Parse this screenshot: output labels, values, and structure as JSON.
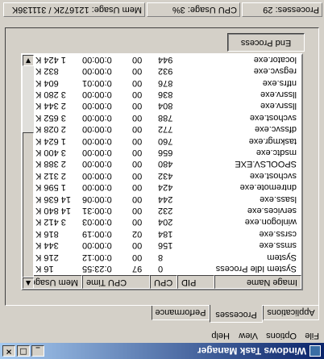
{
  "window": {
    "title": "Windows Task Manager",
    "buttons": [
      "_",
      "□",
      "×"
    ]
  },
  "menu": [
    "File",
    "Options",
    "View",
    "Help"
  ],
  "tabs": [
    "Applications",
    "Processes",
    "Performance"
  ],
  "active_tab": "Processes",
  "columns": [
    "Image Name",
    "PID",
    "CPU",
    "CPU Time",
    "Mem Usage"
  ],
  "processes": [
    {
      "name": "System Idle Process",
      "pid": "0",
      "cpu": "97",
      "time": "0:23:55",
      "mem": "16 K"
    },
    {
      "name": "System",
      "pid": "8",
      "cpu": "00",
      "time": "0:00:12",
      "mem": "216 K"
    },
    {
      "name": "smss.exe",
      "pid": "156",
      "cpu": "00",
      "time": "0:00:00",
      "mem": "344 K"
    },
    {
      "name": "csrss.exe",
      "pid": "184",
      "cpu": "02",
      "time": "0:00:19",
      "mem": "816 K"
    },
    {
      "name": "winlogon.exe",
      "pid": "204",
      "cpu": "00",
      "time": "0:00:03",
      "mem": "3 412 K"
    },
    {
      "name": "services.exe",
      "pid": "232",
      "cpu": "00",
      "time": "0:00:31",
      "mem": "14 840 K"
    },
    {
      "name": "lsass.exe",
      "pid": "244",
      "cpu": "00",
      "time": "0:00:06",
      "mem": "14 636 K"
    },
    {
      "name": "dntremote.exe",
      "pid": "424",
      "cpu": "00",
      "time": "0:00:00",
      "mem": "1 596 K"
    },
    {
      "name": "svchost.exe",
      "pid": "432",
      "cpu": "00",
      "time": "0:00:00",
      "mem": "2 312 K"
    },
    {
      "name": "SPOOLSV.EXE",
      "pid": "480",
      "cpu": "00",
      "time": "0:00:00",
      "mem": "2 388 K"
    },
    {
      "name": "msdtc.exe",
      "pid": "656",
      "cpu": "00",
      "time": "0:00:00",
      "mem": "3 400 K"
    },
    {
      "name": "taskmgr.exe",
      "pid": "760",
      "cpu": "00",
      "time": "0:00:00",
      "mem": "1 624 K"
    },
    {
      "name": "dfssvc.exe",
      "pid": "772",
      "cpu": "00",
      "time": "0:00:00",
      "mem": "2 028 K"
    },
    {
      "name": "svchost.exe",
      "pid": "788",
      "cpu": "00",
      "time": "0:00:00",
      "mem": "3 652 K"
    },
    {
      "name": "llssrv.exe",
      "pid": "804",
      "cpu": "00",
      "time": "0:00:00",
      "mem": "2 344 K"
    },
    {
      "name": "llssrv.exe",
      "pid": "836",
      "cpu": "00",
      "time": "0:00:00",
      "mem": "3 280 K"
    },
    {
      "name": "ntfrs.exe",
      "pid": "876",
      "cpu": "00",
      "time": "0:00:01",
      "mem": "604 K"
    },
    {
      "name": "regsvc.exe",
      "pid": "932",
      "cpu": "00",
      "time": "0:00:00",
      "mem": "832 K"
    },
    {
      "name": "locator.exe",
      "pid": "944",
      "cpu": "00",
      "time": "0:00:00",
      "mem": "1 424 K"
    }
  ],
  "end_process_label": "End Process",
  "status": {
    "processes": "Processes: 29",
    "cpu": "CPU Usage: 3%",
    "mem": "Mem Usage: 121672K / 311136K"
  }
}
